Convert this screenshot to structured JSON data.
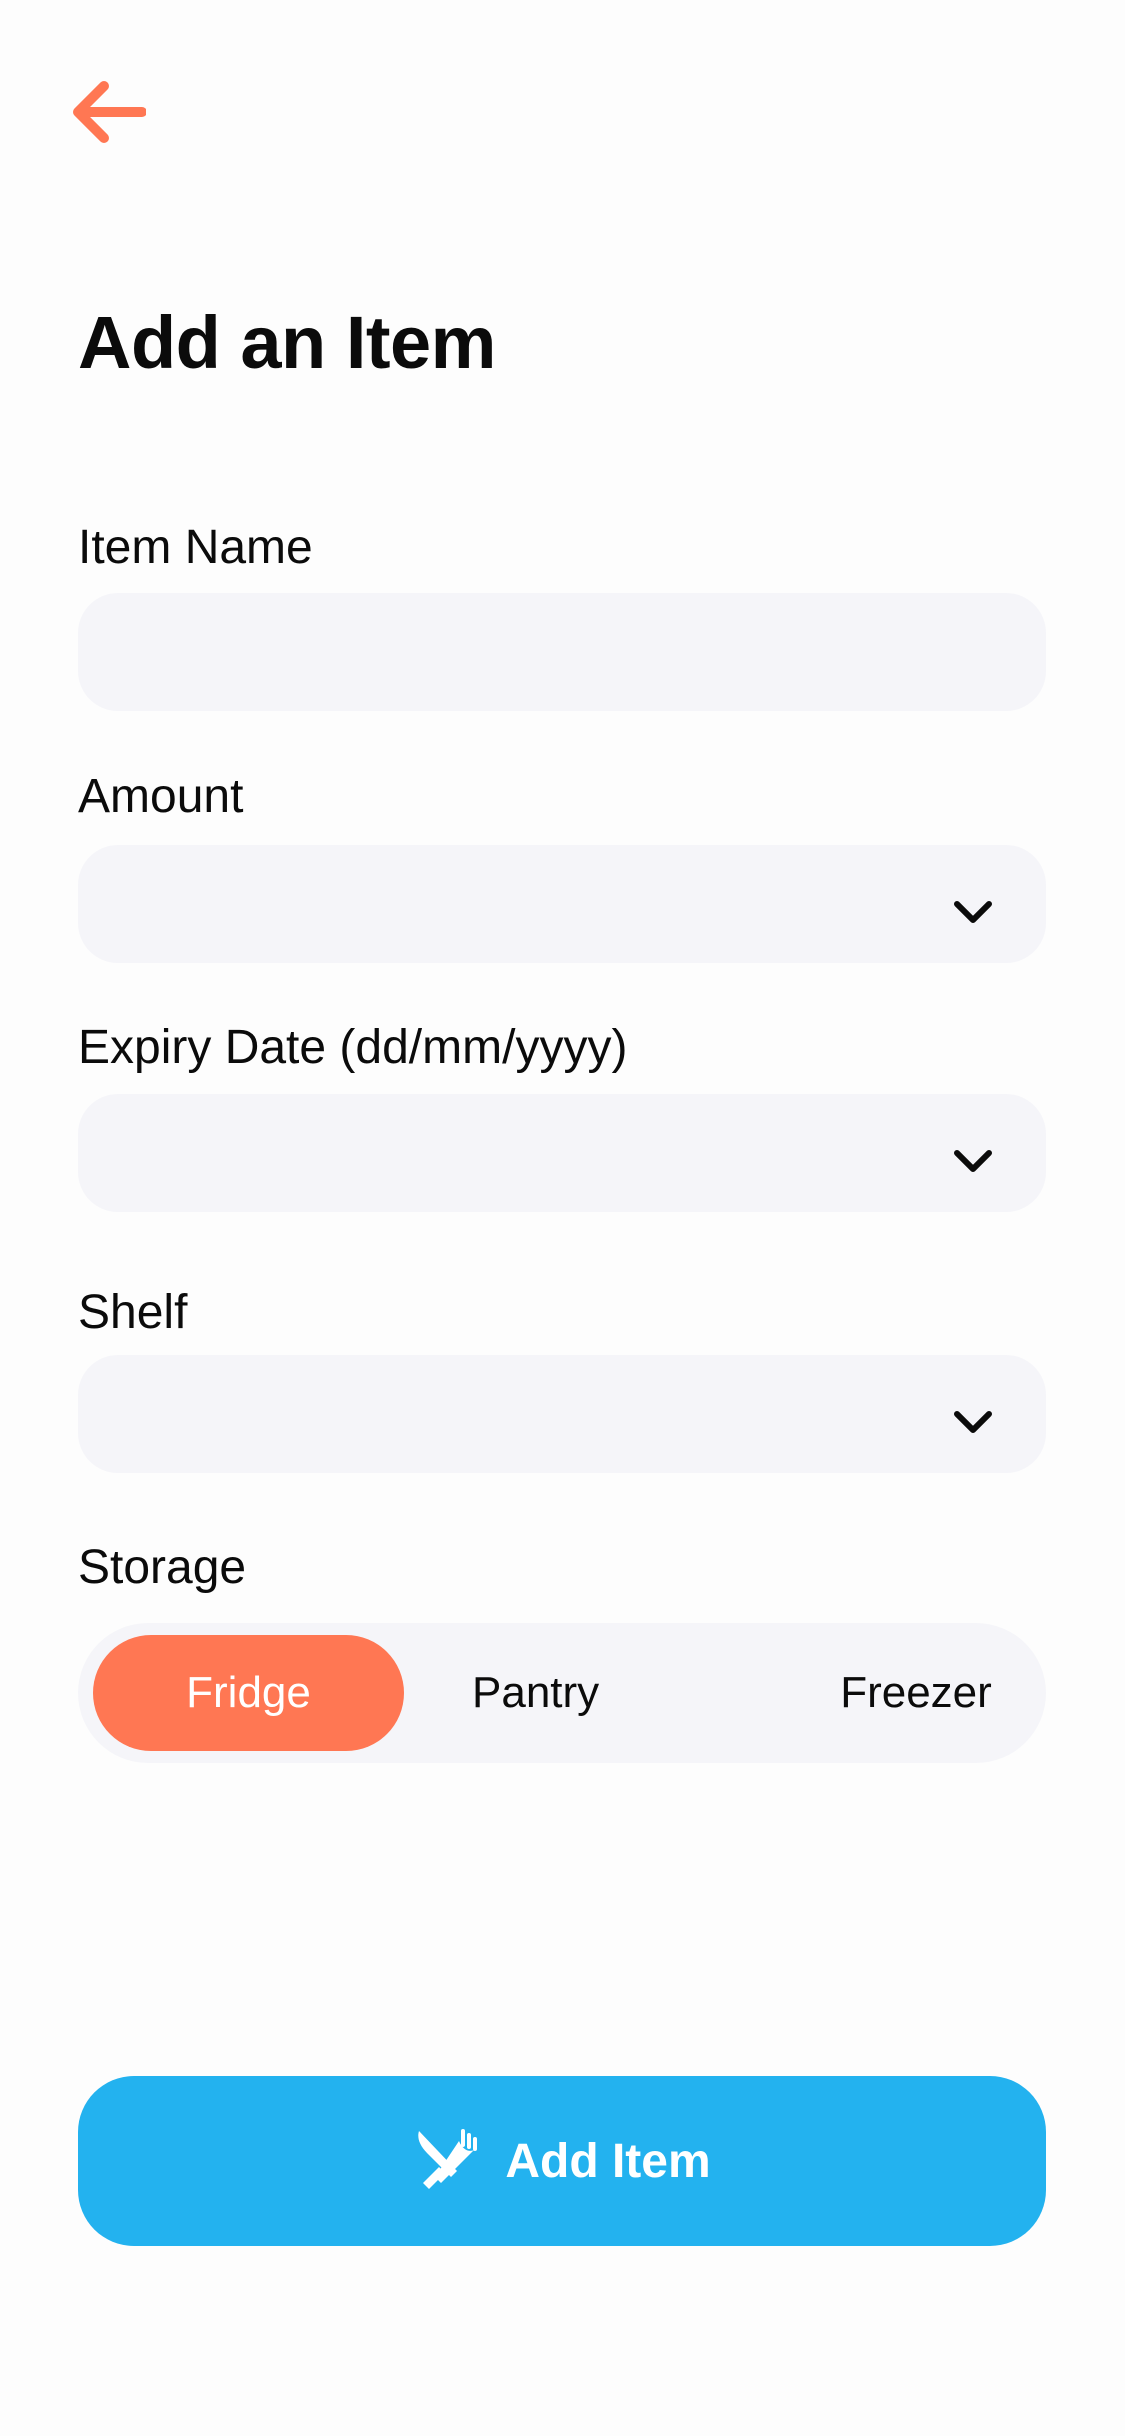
{
  "colors": {
    "accent": "#FF7753",
    "primary": "#23B2EF",
    "field_bg": "#F5F5F9",
    "text": "#0B0B0B"
  },
  "header": {
    "back_icon": "arrow-left-icon",
    "title": "Add an Item"
  },
  "form": {
    "item_name": {
      "label": "Item Name",
      "value": "",
      "placeholder": ""
    },
    "amount": {
      "label": "Amount",
      "value": "",
      "icon": "chevron-down-icon"
    },
    "expiry_date": {
      "label": "Expiry Date (dd/mm/yyyy)",
      "value": "",
      "icon": "chevron-down-icon"
    },
    "shelf": {
      "label": "Shelf",
      "value": "",
      "icon": "chevron-down-icon"
    },
    "storage": {
      "label": "Storage",
      "options": [
        "Fridge",
        "Pantry",
        "Freezer"
      ],
      "selected": "Fridge"
    }
  },
  "submit": {
    "label": "Add Item",
    "icon": "knife-fork-icon"
  }
}
